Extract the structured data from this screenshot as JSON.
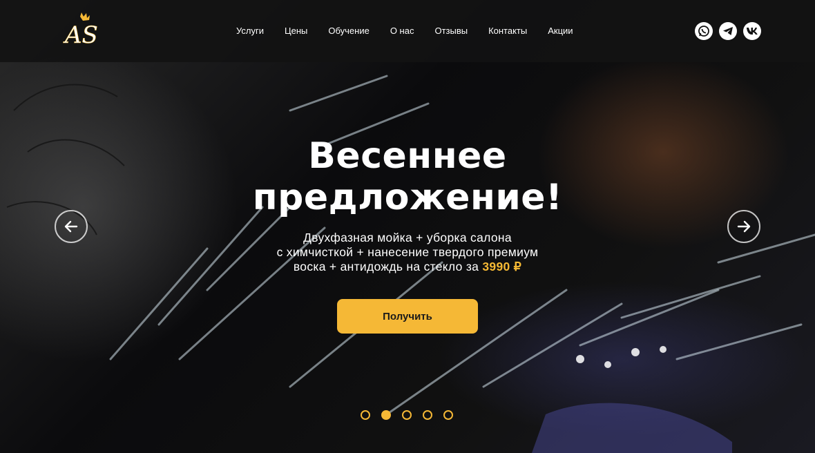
{
  "header": {
    "logo_text": "AS",
    "nav": [
      "Услуги",
      "Цены",
      "Обучение",
      "О нас",
      "Отзывы",
      "Контакты",
      "Акции"
    ],
    "socials": [
      "whatsapp-icon",
      "telegram-icon",
      "vk-icon"
    ]
  },
  "hero": {
    "title_line1": "Весеннее",
    "title_line2": "предложение!",
    "subtitle_line1": "Двухфазная мойка + уборка салона",
    "subtitle_line2": "с химчисткой + нанесение твердого премиум",
    "subtitle_line3": "воска + антидождь на стекло за",
    "price": "3990 ₽",
    "cta_label": "Получить"
  },
  "slider": {
    "total": 5,
    "active_index": 1
  },
  "colors": {
    "accent": "#f5b836",
    "header_bg": "#121212"
  }
}
